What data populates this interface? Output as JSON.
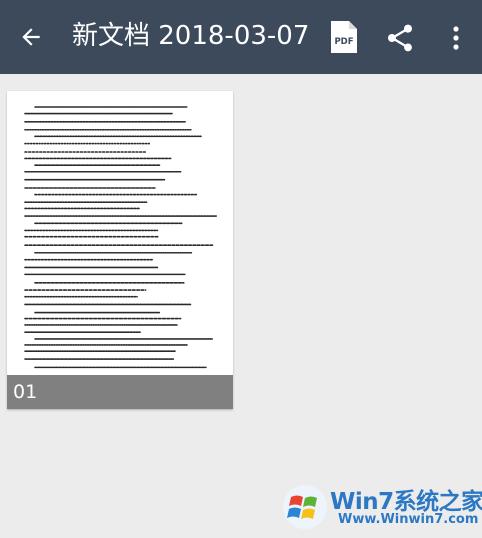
{
  "appbar": {
    "title": "新文档 2018-03-07",
    "icons": {
      "back": "arrow-left-icon",
      "pdf": "pdf-file-icon",
      "share": "share-icon",
      "more": "more-vertical-icon"
    },
    "pdf_icon_text": "PDF"
  },
  "pages": [
    {
      "number": "01"
    }
  ],
  "watermark": {
    "brand": "Win7系统之家",
    "url": "Www.Winwin7.com"
  },
  "colors": {
    "appbar": "#3d4a5c",
    "background": "#ececec",
    "page_label_bar": "#6e6e6e",
    "watermark": "#2c78c4"
  }
}
